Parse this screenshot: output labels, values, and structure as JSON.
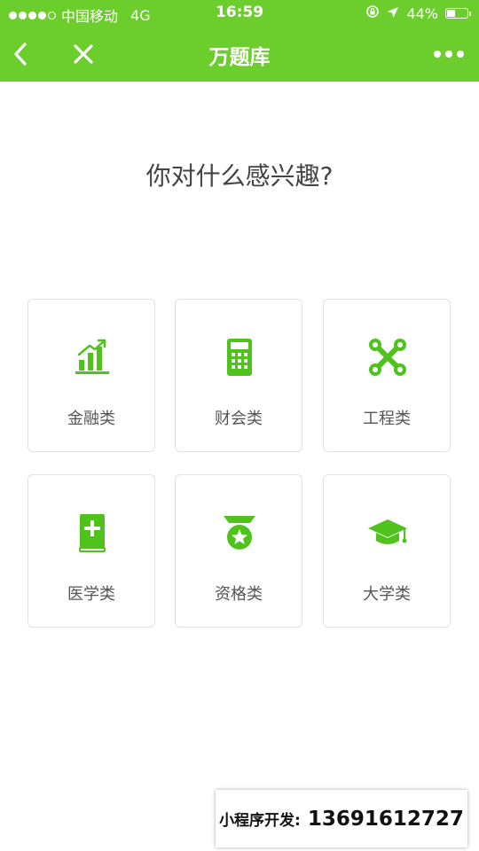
{
  "status_bar": {
    "carrier": "中国移动",
    "network": "4G",
    "time": "16:59",
    "battery_text": "44%",
    "battery_level": 0.44,
    "signal_bars_filled": 4,
    "signal_bars_total": 5
  },
  "nav": {
    "title": "万题库",
    "back_icon": "chevron-left-icon",
    "close_icon": "close-icon",
    "more_icon": "more-dots-icon"
  },
  "main": {
    "prompt": "你对什么感兴趣?",
    "categories": [
      {
        "label": "金融类",
        "icon": "bar-chart-icon"
      },
      {
        "label": "财会类",
        "icon": "calculator-icon"
      },
      {
        "label": "工程类",
        "icon": "wrench-tools-icon"
      },
      {
        "label": "医学类",
        "icon": "medical-book-icon"
      },
      {
        "label": "资格类",
        "icon": "medal-icon"
      },
      {
        "label": "大学类",
        "icon": "graduation-cap-icon"
      }
    ]
  },
  "ad": {
    "label": "小程序开发:",
    "phone": "13691612727"
  },
  "colors": {
    "brand_green": "#6cce2c",
    "icon_green": "#4fc21c",
    "text_dark": "#444444",
    "card_border": "#e2e2e2"
  }
}
